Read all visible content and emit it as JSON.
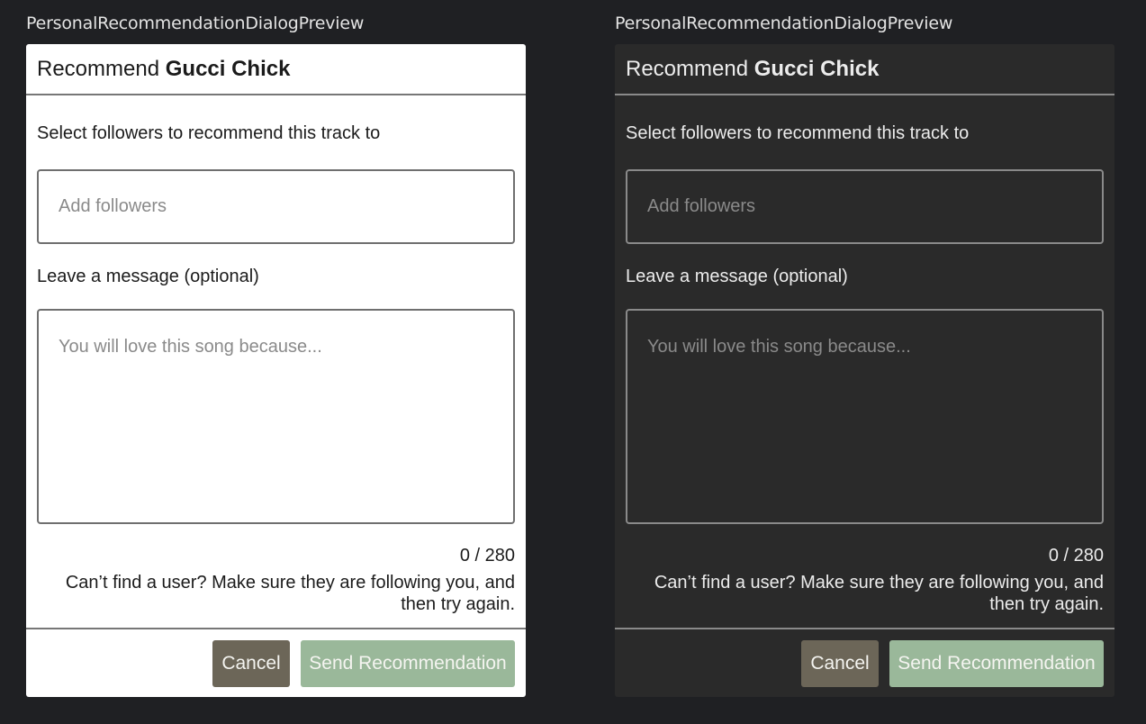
{
  "previews": [
    {
      "label": "PersonalRecommendationDialogPreview",
      "title_prefix": "Recommend",
      "track_name": "Gucci Chick",
      "select_label": "Select followers to recommend this track to",
      "followers_placeholder": "Add followers",
      "message_label": "Leave a message (optional)",
      "message_placeholder": "You will love this song because...",
      "char_counter": "0 / 280",
      "hint": "Can’t find a user? Make sure they are following you, and then try again.",
      "cancel_label": "Cancel",
      "send_label": "Send Recommendation"
    },
    {
      "label": "PersonalRecommendationDialogPreview",
      "title_prefix": "Recommend",
      "track_name": "Gucci Chick",
      "select_label": "Select followers to recommend this track to",
      "followers_placeholder": "Add followers",
      "message_label": "Leave a message (optional)",
      "message_placeholder": "You will love this song because...",
      "char_counter": "0 / 280",
      "hint": "Can’t find a user? Make sure they are following you, and then try again.",
      "cancel_label": "Cancel",
      "send_label": "Send Recommendation"
    }
  ],
  "colors": {
    "canvas": "#1f2023",
    "light_surface": "#ffffff",
    "dark_surface": "#2a2a2a",
    "cancel_button": "#6c6658",
    "send_button": "#9ab89a"
  }
}
